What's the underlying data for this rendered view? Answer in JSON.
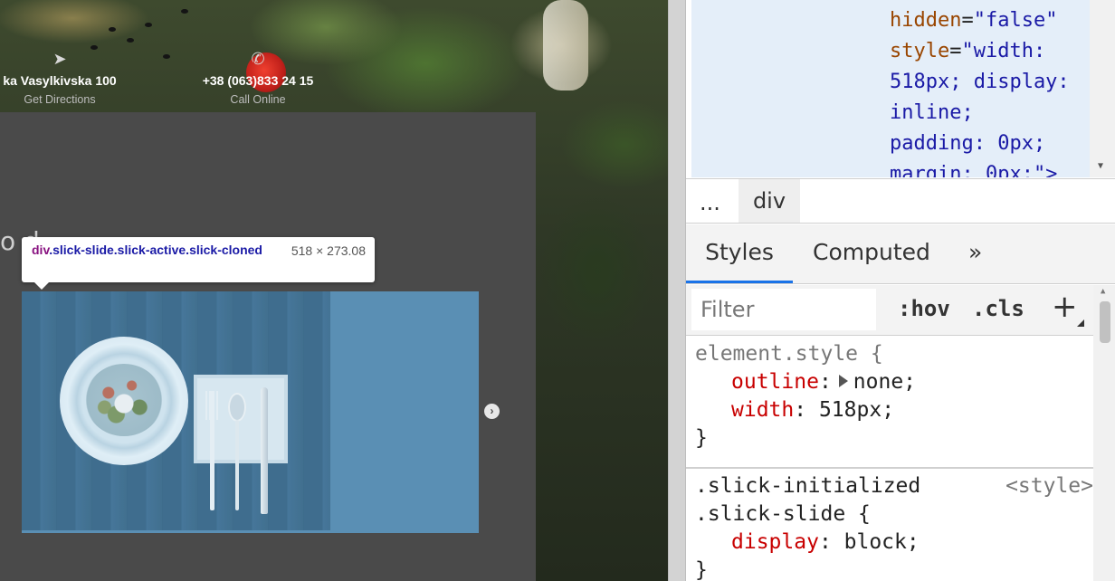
{
  "site": {
    "address": "ka Vasylkivska 100",
    "address_sub": "Get Directions",
    "phone": "+38 (063)833 24 15",
    "phone_sub": "Call Online",
    "partial_heading": "o d",
    "next_arrow": "›"
  },
  "inspector_tooltip": {
    "tag": "div",
    "classes": ".slick-slide.slick-active.slick-cloned",
    "size": "518 × 273.08"
  },
  "dom": {
    "lines": [
      {
        "attr": "hidden",
        "value": "\"false\""
      },
      {
        "attr": "style",
        "value": "\"width:"
      },
      {
        "text": "518px; display:"
      },
      {
        "text": "inline;"
      },
      {
        "text": "padding: 0px;"
      },
      {
        "text": "margin: 0px;\">"
      }
    ]
  },
  "breadcrumbs": {
    "dots": "...",
    "current": "div"
  },
  "tabs": {
    "styles": "Styles",
    "computed": "Computed",
    "more": "»"
  },
  "filter": {
    "placeholder": "Filter",
    "hov": ":hov",
    "cls": ".cls",
    "add": "+"
  },
  "styles": {
    "element_style": {
      "selector": "element.style {",
      "props": [
        {
          "name": "outline",
          "value": "none;"
        },
        {
          "name": "width",
          "value": "518px;"
        }
      ],
      "close": "}"
    },
    "rule2": {
      "selector_line1": ".slick-initialized",
      "selector_line2": ".slick-slide {",
      "source": "<style>",
      "props": [
        {
          "name": "display",
          "value": "block;"
        }
      ],
      "close": "}"
    }
  }
}
